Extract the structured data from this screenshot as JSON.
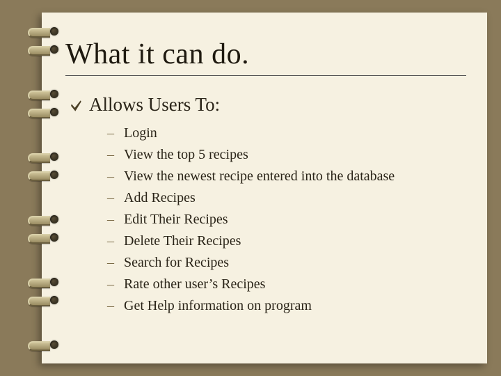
{
  "title": "What it can do.",
  "main_bullet": {
    "label": "Allows Users To:"
  },
  "sub_bullets": [
    {
      "label": "Login"
    },
    {
      "label": "View the top 5 recipes"
    },
    {
      "label": "View the newest recipe entered into the database"
    },
    {
      "label": "Add Recipes"
    },
    {
      "label": "Edit Their Recipes"
    },
    {
      "label": "Delete Their Recipes"
    },
    {
      "label": "Search for Recipes"
    },
    {
      "label": "Rate other user’s Recipes"
    },
    {
      "label": "Get Help information on program"
    }
  ],
  "dash_char": "–"
}
